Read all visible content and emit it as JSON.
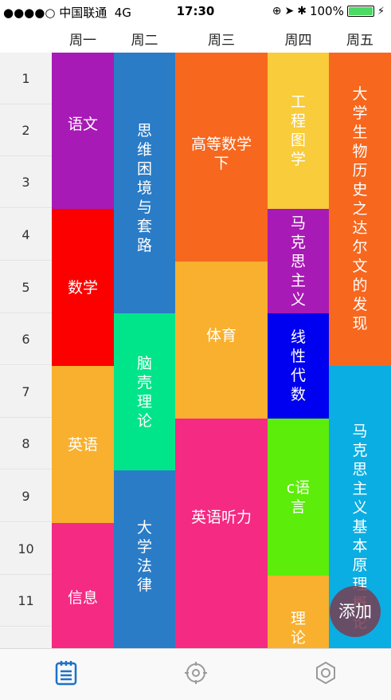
{
  "status": {
    "carrier": "●●●●○ 中国联通",
    "network": "4G",
    "time": "17:30",
    "battery": "100%"
  },
  "days": [
    "周一",
    "周二",
    "周三",
    "周四",
    "周五"
  ],
  "periods": [
    "1",
    "2",
    "3",
    "4",
    "5",
    "6",
    "7",
    "8",
    "9",
    "10",
    "11"
  ],
  "courses": {
    "c1": "语文",
    "c2": "数学",
    "c3": "英语",
    "c4": "信息",
    "c5": "思维困境与套路",
    "c6": "脑壳理论",
    "c7": "大学法律",
    "c8": "高等数学下",
    "c9": "体育",
    "c10": "英语听力",
    "c11": "工程图学",
    "c12": "马克思主义",
    "c13": "线性代数",
    "c14": "c语言",
    "c15": "理论",
    "c16": "大学生物历史之达尔文的发现",
    "c17": "马克思主义基本原理概论"
  },
  "fab_label": "添加",
  "tabs": [
    "schedule-icon",
    "explore-icon",
    "settings-icon"
  ],
  "colors": {
    "accent": "#1a73c8"
  }
}
